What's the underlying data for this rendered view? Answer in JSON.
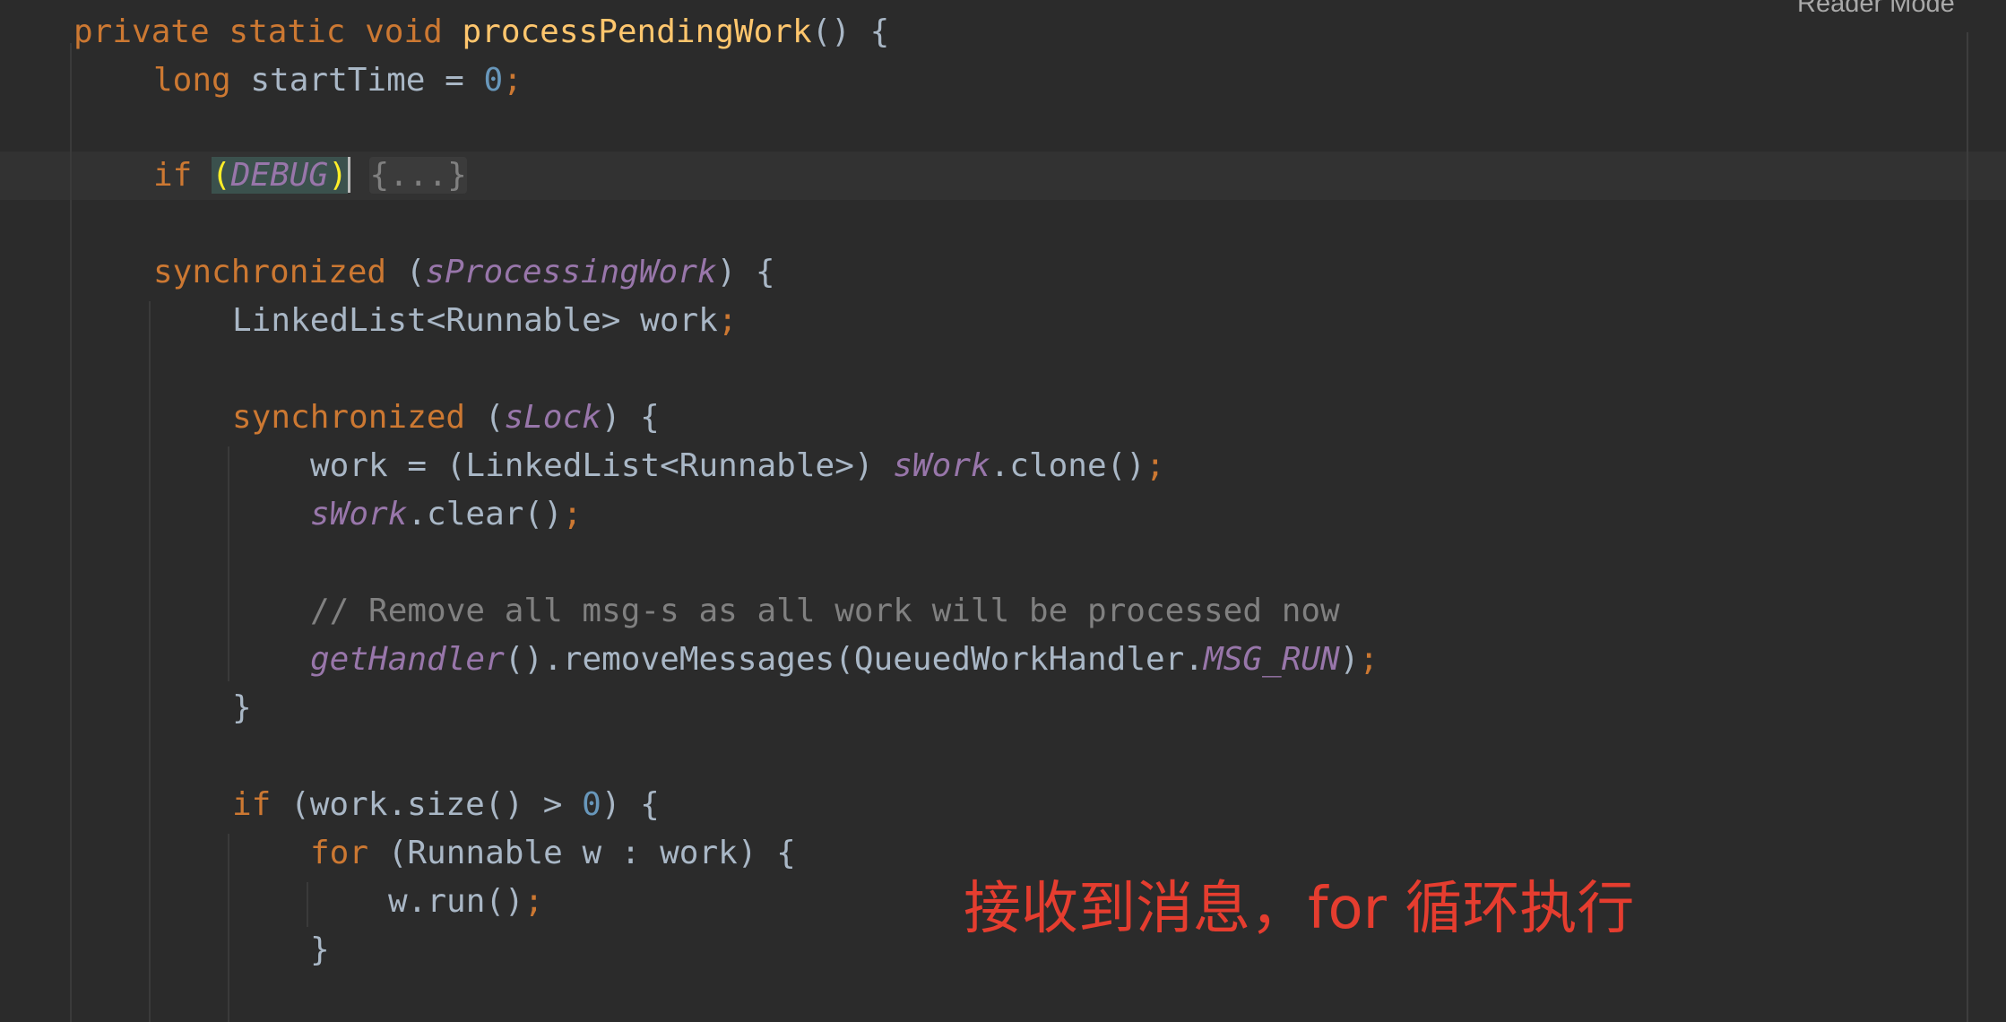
{
  "editor": {
    "reader_mode_label": "Reader Mode",
    "lines": {
      "l1": {
        "kw": "private static void ",
        "fn": "processPendingWork",
        "rest": "() {"
      },
      "l2": {
        "kw": "long ",
        "a": "startTime = ",
        "num": "0",
        "semi": ";"
      },
      "l3": {
        "kw": "if ",
        "open": "(",
        "fld": "DEBUG",
        "close": ")",
        "fold": "{...}"
      },
      "l4": {
        "kw": "synchronized ",
        "open": "(",
        "fld": "sProcessingWork",
        "close": ") {"
      },
      "l5": {
        "a": "LinkedList<Runnable> work",
        "semi": ";"
      },
      "l6": {
        "kw": "synchronized ",
        "open": "(",
        "fld": "sLock",
        "close": ") {"
      },
      "l7": {
        "a": "work = (LinkedList<Runnable>) ",
        "fld": "sWork",
        "b": ".clone()",
        "semi": ";"
      },
      "l8": {
        "fld": "sWork",
        "b": ".clear()",
        "semi": ";"
      },
      "l9": {
        "cmt": "// Remove all msg-s as all work will be processed now"
      },
      "l10": {
        "fld": "getHandler",
        "a": "().removeMessages(QueuedWorkHandler.",
        "fld2": "MSG_RUN",
        "b": ")",
        "semi": ";"
      },
      "l11": {
        "a": "}"
      },
      "l12": {
        "kw": "if ",
        "a": "(work.size() > ",
        "num": "0",
        "b": ") {"
      },
      "l13": {
        "kw": "for ",
        "a": "(Runnable w : work) {"
      },
      "l14": {
        "a": "w.run()",
        "semi": ";"
      },
      "l15": {
        "a": "}"
      }
    }
  },
  "annotation": {
    "text": "接收到消息，for 循环执行"
  },
  "colors": {
    "background": "#2b2b2b",
    "keyword": "#cc7832",
    "function": "#ffc66d",
    "number": "#6897bb",
    "field": "#9876aa",
    "comment": "#808080",
    "annotation": "#e53d2f"
  }
}
